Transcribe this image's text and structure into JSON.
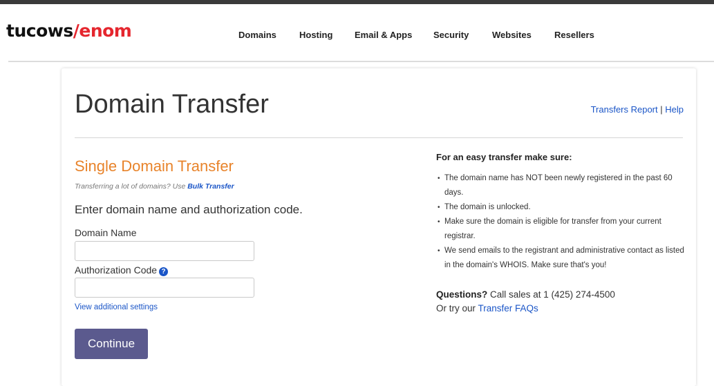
{
  "logo": {
    "part1": "tucows",
    "slash": "/",
    "part2": "enom"
  },
  "nav": {
    "items": [
      {
        "label": "Domains"
      },
      {
        "label": "Hosting"
      },
      {
        "label": "Email & Apps"
      },
      {
        "label": "Security"
      },
      {
        "label": "Websites"
      },
      {
        "label": "Resellers"
      }
    ]
  },
  "page": {
    "title": "Domain Transfer",
    "transfers_report_link": "Transfers Report",
    "separator": " | ",
    "help_link": "Help"
  },
  "form": {
    "heading": "Single Domain Transfer",
    "bulk_note": "Transferring a lot of domains? Use ",
    "bulk_link": "Bulk Transfer",
    "instruction": "Enter domain name and authorization code.",
    "domain_label": "Domain Name",
    "domain_value": "",
    "auth_label": "Authorization Code",
    "auth_help_icon": "?",
    "auth_value": "",
    "additional_settings_link": "View additional settings",
    "continue_button": "Continue"
  },
  "tips": {
    "heading": "For an easy transfer make sure:",
    "items": [
      "The domain name has NOT been newly registered in the past 60 days.",
      "The domain is unlocked.",
      "Make sure the domain is eligible for transfer from your current registrar.",
      "We send emails to the registrant and administrative contact as listed in the domain's WHOIS. Make sure that's you!"
    ],
    "questions_bold": "Questions?",
    "questions_text": " Call sales at 1 (425) 274-4500",
    "faq_prefix": "Or try our ",
    "faq_link": "Transfer FAQs"
  },
  "colors": {
    "accent_orange": "#e8832a",
    "link_blue": "#1a55c7",
    "button_purple": "#5b5a8e",
    "logo_red": "#e5262e"
  }
}
